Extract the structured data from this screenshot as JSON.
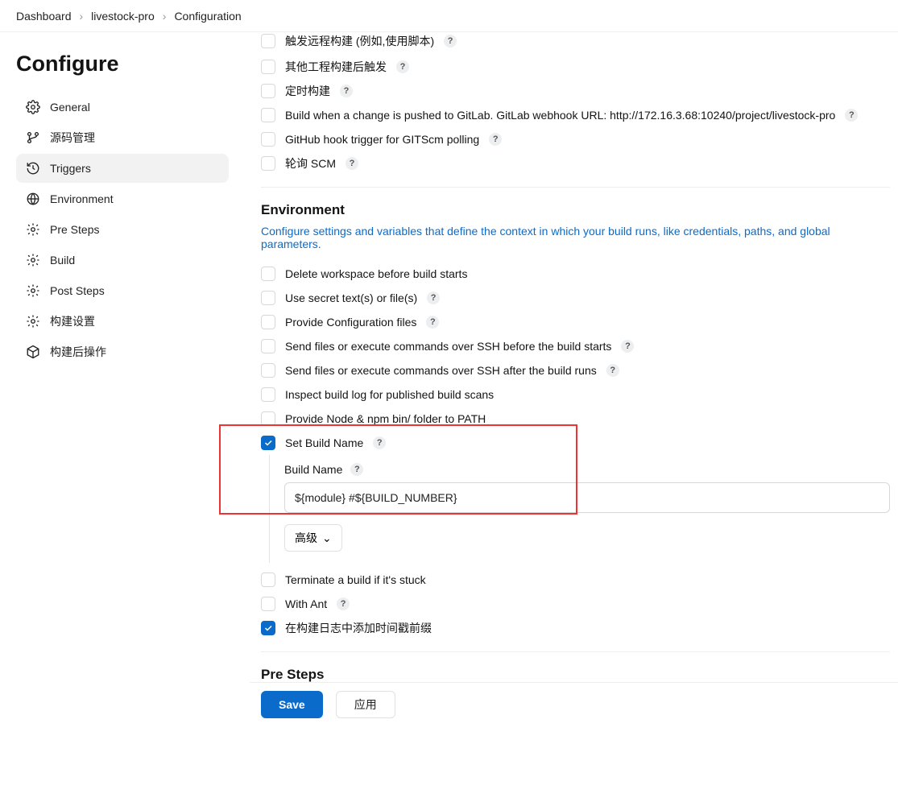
{
  "breadcrumb": {
    "dashboard": "Dashboard",
    "project": "livestock-pro",
    "configuration": "Configuration"
  },
  "sidebar": {
    "title": "Configure",
    "items": [
      {
        "label": "General"
      },
      {
        "label": "源码管理"
      },
      {
        "label": "Triggers"
      },
      {
        "label": "Environment"
      },
      {
        "label": "Pre Steps"
      },
      {
        "label": "Build"
      },
      {
        "label": "Post Steps"
      },
      {
        "label": "构建设置"
      },
      {
        "label": "构建后操作"
      }
    ]
  },
  "triggers": {
    "items": [
      {
        "label": "触发远程构建 (例如,使用脚本)",
        "help": true
      },
      {
        "label": "其他工程构建后触发",
        "help": true
      },
      {
        "label": "定时构建",
        "help": true
      },
      {
        "label": "Build when a change is pushed to GitLab. GitLab webhook URL: http://172.16.3.68:10240/project/livestock-pro",
        "help": true
      },
      {
        "label": "GitHub hook trigger for GITScm polling",
        "help": true
      },
      {
        "label": "轮询 SCM",
        "help": true
      }
    ]
  },
  "environment": {
    "title": "Environment",
    "desc": "Configure settings and variables that define the context in which your build runs, like credentials, paths, and global parameters.",
    "items": [
      {
        "label": "Delete workspace before build starts",
        "help": false,
        "checked": false
      },
      {
        "label": "Use secret text(s) or file(s)",
        "help": true,
        "checked": false
      },
      {
        "label": "Provide Configuration files",
        "help": true,
        "checked": false
      },
      {
        "label": "Send files or execute commands over SSH before the build starts",
        "help": true,
        "checked": false
      },
      {
        "label": "Send files or execute commands over SSH after the build runs",
        "help": true,
        "checked": false
      },
      {
        "label": "Inspect build log for published build scans",
        "help": false,
        "checked": false
      },
      {
        "label": "Provide Node & npm bin/ folder to PATH",
        "help": false,
        "checked": false
      },
      {
        "label": "Set Build Name",
        "help": true,
        "checked": true
      },
      {
        "label": "Terminate a build if it's stuck",
        "help": false,
        "checked": false
      },
      {
        "label": "With Ant",
        "help": true,
        "checked": false
      },
      {
        "label": "在构建日志中添加时间戳前缀",
        "help": false,
        "checked": true
      }
    ],
    "buildName": {
      "label": "Build Name",
      "value": "${module} #${BUILD_NUMBER}"
    },
    "advanced": "高级"
  },
  "preSteps": {
    "title": "Pre Steps"
  },
  "footer": {
    "save": "Save",
    "apply": "应用"
  },
  "help_glyph": "?"
}
